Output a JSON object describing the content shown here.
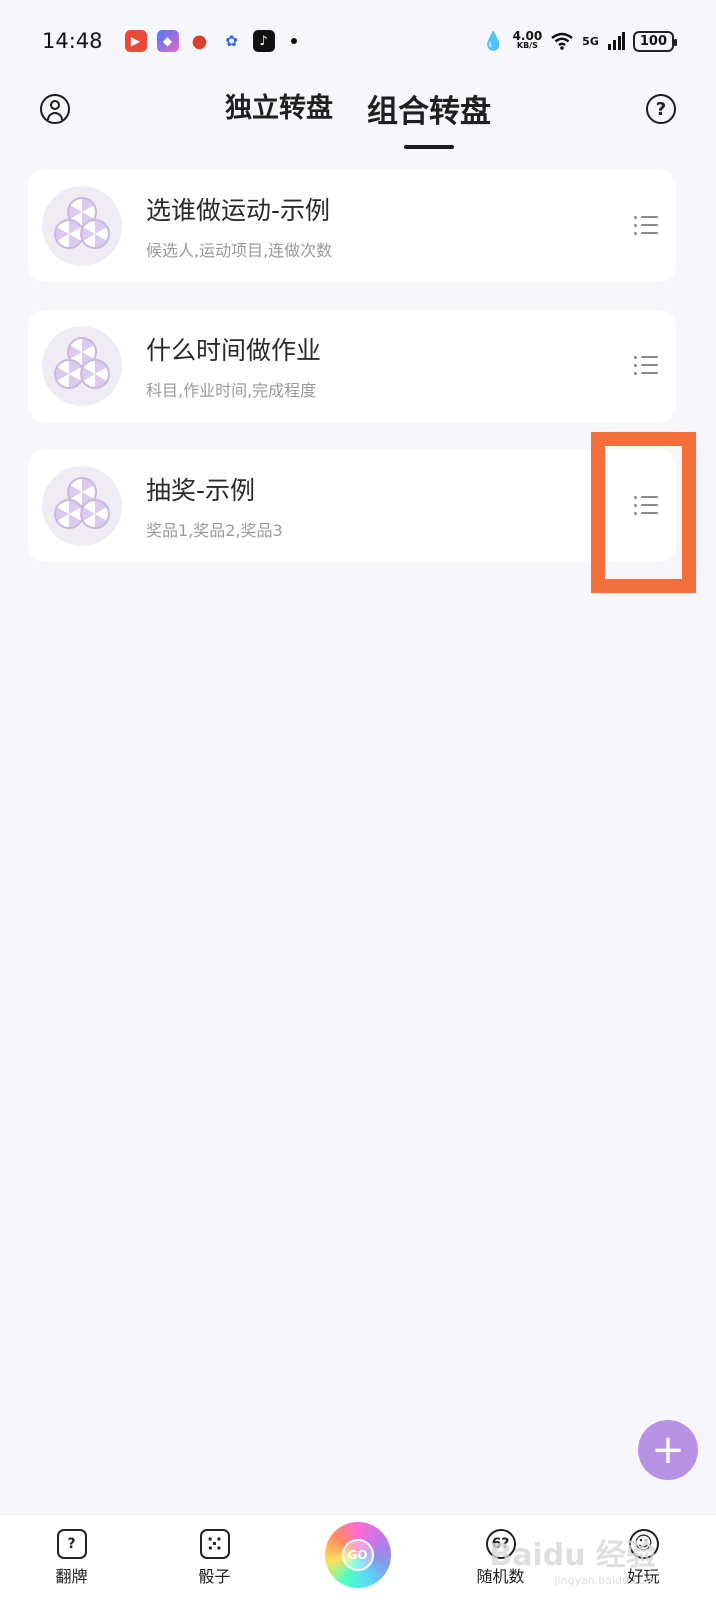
{
  "status": {
    "time": "14:48",
    "net_speed": "4.00",
    "net_unit": "KB/S",
    "network": "5G",
    "battery": "100"
  },
  "header": {
    "tabs": [
      {
        "label": "独立转盘",
        "active": false
      },
      {
        "label": "组合转盘",
        "active": true
      }
    ],
    "help_glyph": "?"
  },
  "list": {
    "items": [
      {
        "title": "选谁做运动-示例",
        "subtitle": "候选人,运动项目,连做次数"
      },
      {
        "title": "什么时间做作业",
        "subtitle": "科目,作业时间,完成程度"
      },
      {
        "title": "抽奖-示例",
        "subtitle": "奖品1,奖品2,奖品3"
      }
    ]
  },
  "fab": {
    "label": "+"
  },
  "bottom_nav": {
    "items": [
      {
        "label": "翻牌",
        "icon": "?"
      },
      {
        "label": "骰子",
        "icon": "⁙"
      },
      {
        "label": "GO",
        "icon": "go"
      },
      {
        "label": "随机数",
        "icon": "6?"
      },
      {
        "label": "好玩",
        "icon": "☺"
      }
    ]
  },
  "watermark": {
    "text": "Baidu 经验",
    "sub": "jingyan.baidu.com"
  },
  "colors": {
    "accent": "#b893e3",
    "highlight": "#f36f3b",
    "background": "#f7f6fb"
  }
}
